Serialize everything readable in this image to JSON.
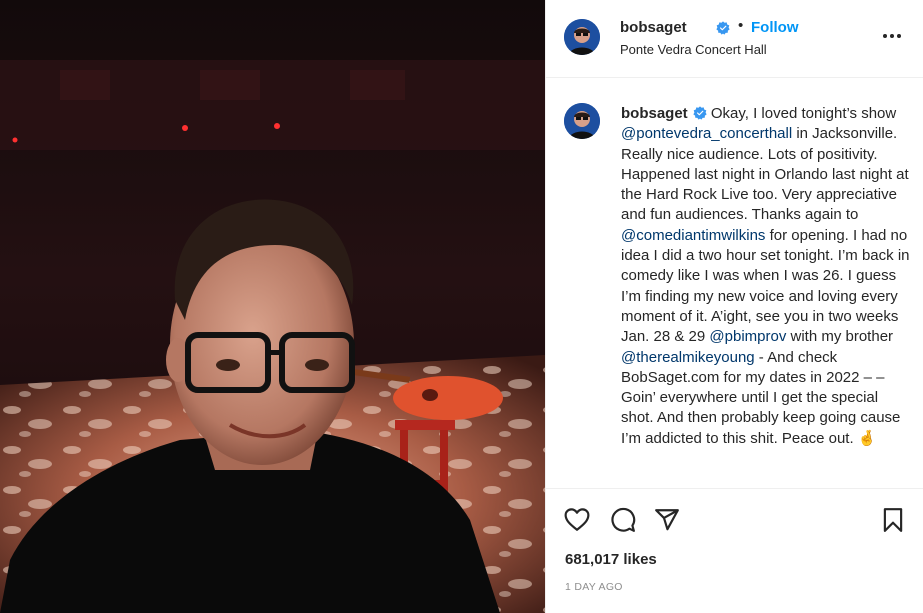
{
  "post": {
    "username": "bobsaget",
    "follow_label": "Follow",
    "separator": "•",
    "location": "Ponte Vedra Concert Hall",
    "caption": {
      "t1": "Okay, I loved tonight’s show ",
      "m1": "@pontevedra_concerthall",
      "t2": " in Jacksonville. Really nice audience. Lots of positivity. Happened last night in Orlando last night at the Hard Rock Live too. Very appreciative and fun audiences. Thanks again to ",
      "m2": "@comediantimwilkins",
      "t3": " for opening. I had no idea I did a two hour set tonight. I’m back in comedy like I was when I was 26. I guess I’m finding my new voice and loving every moment of it. A’ight, see you in two weeks Jan. 28 & 29 ",
      "m3": "@pbimprov",
      "t4": " with my brother ",
      "m4": "@therealmikeyoung",
      "t5": " - And check BobSaget.com for my dates in 2022 – – Goin’ everywhere until I get the special shot. And then probably keep going cause I’m addicted to this shit. Peace out.",
      "emoji": "🤞"
    },
    "likes": "681,017 likes",
    "timestamp": "1 DAY AGO"
  },
  "icons": {
    "verified": "verified-badge-icon",
    "more": "more-options-icon",
    "like": "heart-icon",
    "comment": "comment-icon",
    "share": "paper-plane-icon",
    "save": "bookmark-icon"
  },
  "colors": {
    "accent": "#0095f6",
    "mention": "#00376b",
    "muted": "#8e8e8e",
    "verified": "#3897f0"
  }
}
